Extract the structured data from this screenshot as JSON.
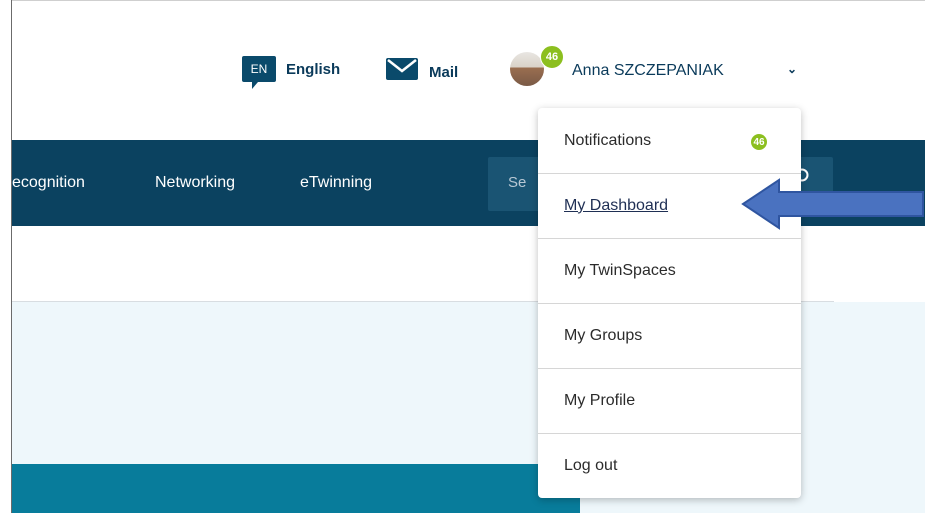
{
  "header": {
    "language_code": "EN",
    "language_label": "English",
    "mail_label": "Mail",
    "notification_count": "46",
    "user_name": "Anna SZCZEPANIAK",
    "chevron_icon": "chevron-down-icon"
  },
  "nav": {
    "items": [
      "ecognition",
      "Networking",
      "eTwinning"
    ],
    "search_placeholder": "Se"
  },
  "dropdown": {
    "items": [
      {
        "label": "Notifications",
        "badge": "46"
      },
      {
        "label": "My Dashboard"
      },
      {
        "label": "My TwinSpaces"
      },
      {
        "label": "My Groups"
      },
      {
        "label": "My Profile"
      },
      {
        "label": "Log out"
      }
    ],
    "highlighted": "My Dashboard"
  },
  "colors": {
    "nav_bg": "#0b4260",
    "badge": "#8cbf1f",
    "arrow": "#4a72c0",
    "teal_banner": "#087c9b",
    "hero_bg": "#eef7fb"
  }
}
